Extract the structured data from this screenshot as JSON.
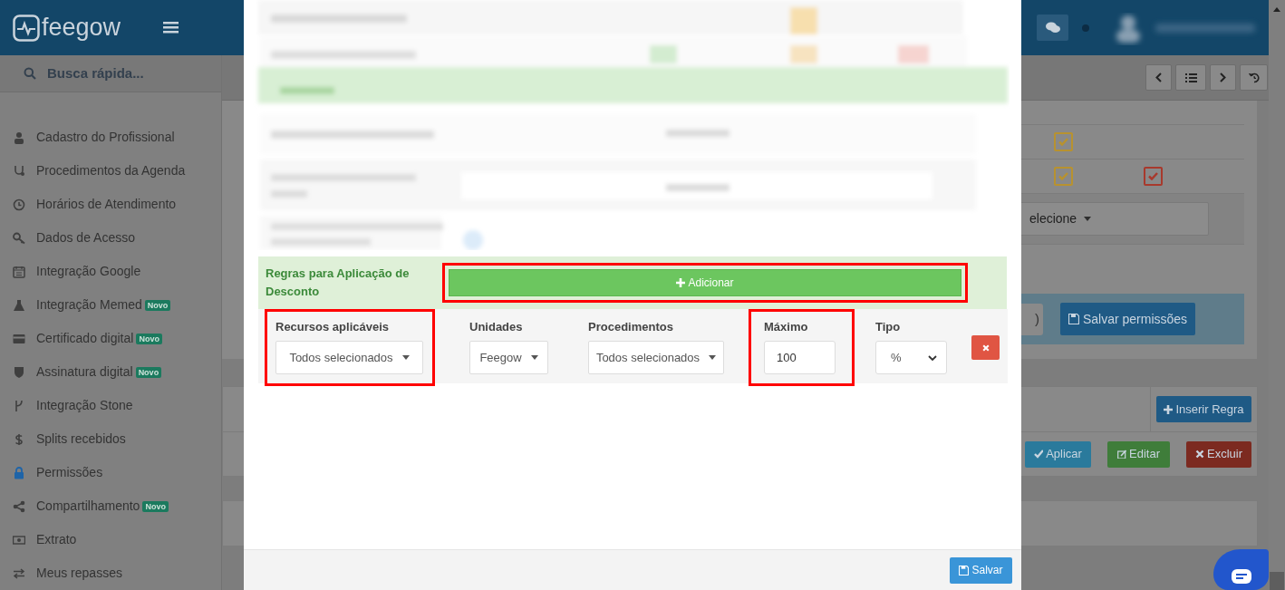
{
  "header": {
    "logo_text": "feegow"
  },
  "search": {
    "placeholder": "Busca rápida..."
  },
  "sidebar": {
    "items": [
      {
        "label": "Cadastro do Profissional",
        "selected": false
      },
      {
        "label": "Procedimentos da Agenda",
        "selected": false
      },
      {
        "label": "Horários de Atendimento",
        "selected": false
      },
      {
        "label": "Dados de Acesso",
        "selected": false
      },
      {
        "label": "Integração Google",
        "selected": false
      },
      {
        "label": "Integração Memed",
        "badge": "Novo",
        "selected": false
      },
      {
        "label": "Certificado digital",
        "badge": "Novo",
        "selected": false
      },
      {
        "label": "Assinatura digital",
        "badge": "Novo",
        "selected": false
      },
      {
        "label": "Integração Stone",
        "selected": false
      },
      {
        "label": "Splits recebidos",
        "selected": false
      },
      {
        "label": "Permissões",
        "selected": true
      },
      {
        "label": "Compartilhamento",
        "badge": "Novo",
        "selected": false
      },
      {
        "label": "Extrato",
        "selected": false
      },
      {
        "label": "Meus repasses",
        "selected": false
      }
    ]
  },
  "background": {
    "checkbox_rows": [
      [
        {
          "checked": true,
          "color": "#b8922f"
        }
      ],
      [
        {
          "checked": true,
          "color": "#b8922f"
        },
        {
          "checked": true,
          "color": "#a8392c"
        }
      ]
    ],
    "select": {
      "value": "elecione"
    },
    "input_fragment": ")",
    "save_permissions_button": "Salvar permissões",
    "insert_rule_button": "Inserir Regra",
    "action_buttons": [
      {
        "label": "Aplicar",
        "color": "#2a7a9c"
      },
      {
        "label": "Editar",
        "color": "#3f7d3a"
      },
      {
        "label": "Excluir",
        "color": "#7c2a20"
      }
    ]
  },
  "modal": {
    "rules_label": "Regras para Aplicação de Desconto",
    "add_button": {
      "label": "Adicionar",
      "highlighted": true
    },
    "fields": [
      {
        "kind": "select",
        "label": "Recursos aplicáveis",
        "value": "Todos selecionados",
        "highlighted": true
      },
      {
        "kind": "select",
        "label": "Unidades",
        "value": "Feegow",
        "highlighted": false
      },
      {
        "kind": "select",
        "label": "Procedimentos",
        "value": "Todos selecionados",
        "highlighted": false
      },
      {
        "kind": "input",
        "label": "Máximo",
        "value": "100",
        "highlighted": true
      },
      {
        "kind": "native-select",
        "label": "Tipo",
        "value": "%",
        "highlighted": false
      }
    ],
    "save_button": "Salvar"
  }
}
